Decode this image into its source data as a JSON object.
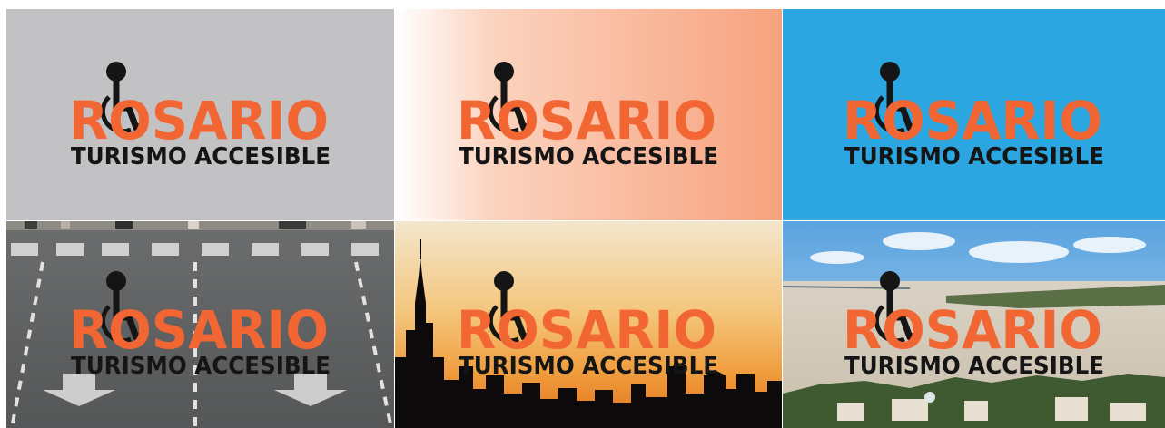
{
  "logo": {
    "brand": "ROSARIO",
    "tagline": "TURISMO ACCESIBLE",
    "symbol": "wheelchair-icon",
    "colors": {
      "brand": "#f26633",
      "tagline": "#151515",
      "symbol": "#151515"
    }
  },
  "tiles": [
    {
      "background": "plain-gray",
      "color": "#c2c2c4"
    },
    {
      "background": "white-to-orange-gradient",
      "colors": [
        "#ffffff",
        "#f7a27e"
      ]
    },
    {
      "background": "plain-blue",
      "color": "#2ba6e1"
    },
    {
      "background": "photo-street-crosswalk"
    },
    {
      "background": "photo-city-skyline-sunset"
    },
    {
      "background": "photo-river-aerial-city"
    }
  ]
}
